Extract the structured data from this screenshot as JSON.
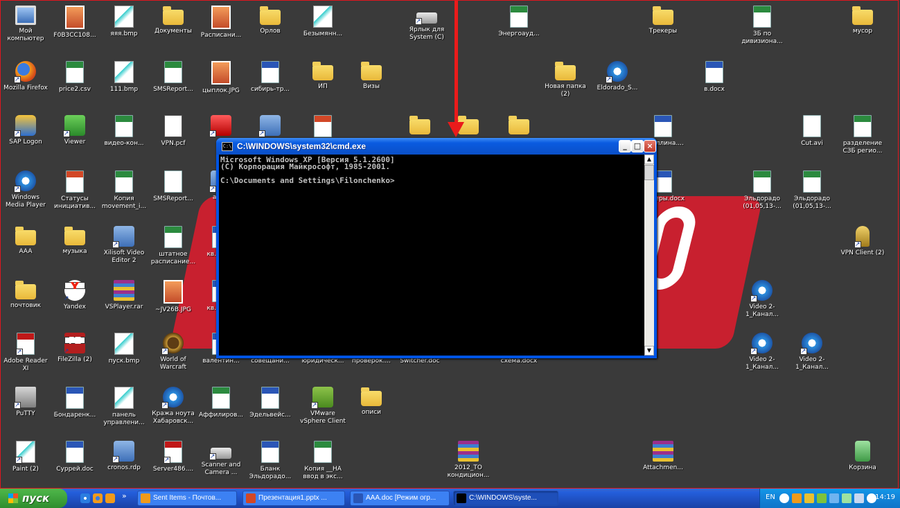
{
  "desktop": {
    "icons": [
      {
        "label": "Мой компьютер",
        "type": "computer"
      },
      {
        "label": "F0B3CC108...",
        "type": "jpg"
      },
      {
        "label": "яяя.bmp",
        "type": "paint"
      },
      {
        "label": "Документы",
        "type": "folder"
      },
      {
        "label": "Расписани...",
        "type": "jpg"
      },
      {
        "label": "Орлов",
        "type": "folder"
      },
      {
        "label": "Безымянн...",
        "type": "paint"
      },
      {
        "label": "Ярлык для System (C)",
        "type": "drive"
      },
      {
        "label": "Энергоауд...",
        "type": "excel"
      },
      {
        "label": "Трекеры",
        "type": "folder"
      },
      {
        "label": "3Б по дивизиона...",
        "type": "excel"
      },
      {
        "label": "мусор",
        "type": "folder"
      },
      {
        "label": "Mozilla Firefox",
        "type": "firefox"
      },
      {
        "label": "price2.csv",
        "type": "excel"
      },
      {
        "label": "111.bmp",
        "type": "paint"
      },
      {
        "label": "SMSReport...",
        "type": "excel"
      },
      {
        "label": "цыплок.JPG",
        "type": "jpg"
      },
      {
        "label": "сибирь-тр...",
        "type": "word"
      },
      {
        "label": "ИП",
        "type": "folder"
      },
      {
        "label": "Визы",
        "type": "folder"
      },
      {
        "label": "Новая папка (2)",
        "type": "folder"
      },
      {
        "label": "Eldorado_S...",
        "type": "media"
      },
      {
        "label": "в.docx",
        "type": "word"
      },
      {
        "label": "SAP Logon",
        "type": "sap"
      },
      {
        "label": "Viewer",
        "type": "green"
      },
      {
        "label": "видео-кон...",
        "type": "excel"
      },
      {
        "label": "VPN.pcf",
        "type": "pcf"
      },
      {
        "label": "",
        "type": "red"
      },
      {
        "label": "",
        "type": "generic"
      },
      {
        "label": "",
        "type": "ppt"
      },
      {
        "label": "",
        "type": "folder"
      },
      {
        "label": "",
        "type": "folder"
      },
      {
        "label": "",
        "type": "folder"
      },
      {
        "label": "...ауллина....",
        "type": "word"
      },
      {
        "label": "Cut.avi",
        "type": "doc"
      },
      {
        "label": "разделение СЗБ регио...",
        "type": "excel"
      },
      {
        "label": "Windows Media Player",
        "type": "media"
      },
      {
        "label": "Статусы инициатив...",
        "type": "ppt"
      },
      {
        "label": "Копия movement_i...",
        "type": "excel"
      },
      {
        "label": "SMSReport...",
        "type": "doc"
      },
      {
        "label": "а_2...",
        "type": "generic"
      },
      {
        "label": "...екеры.docx",
        "type": "word"
      },
      {
        "label": "Эльдорадо (01,05,13-...",
        "type": "excel"
      },
      {
        "label": "Эльдорадо (01,05,13-...",
        "type": "excel"
      },
      {
        "label": "AAA",
        "type": "folder"
      },
      {
        "label": "музыка",
        "type": "folder"
      },
      {
        "label": "Xilisoft Video Editor 2",
        "type": "generic"
      },
      {
        "label": "штатное расписание...",
        "type": "excel"
      },
      {
        "label": "кв... св...",
        "type": "word"
      },
      {
        "label": "VPN Client (2)",
        "type": "vpn"
      },
      {
        "label": "почтовик",
        "type": "folder"
      },
      {
        "label": "Yandex",
        "type": "yandex"
      },
      {
        "label": "VSPlayer.rar",
        "type": "rar"
      },
      {
        "label": "~JV26B.JPG",
        "type": "jpg"
      },
      {
        "label": "кв... св...",
        "type": "word"
      },
      {
        "label": "Video 2-1_Канал...",
        "type": "media"
      },
      {
        "label": "Adobe Reader XI",
        "type": "pdf"
      },
      {
        "label": "FileZilla (2)",
        "type": "filezilla"
      },
      {
        "label": "пуск.bmp",
        "type": "paint"
      },
      {
        "label": "World of Warcraft",
        "type": "wow"
      },
      {
        "label": "валентин...",
        "type": "word"
      },
      {
        "label": "совещани...",
        "type": "word"
      },
      {
        "label": "юридическ...",
        "type": "word"
      },
      {
        "label": "проверок....",
        "type": "word"
      },
      {
        "label": "Switcher.doc",
        "type": "word"
      },
      {
        "label": "схема.docx",
        "type": "word"
      },
      {
        "label": "Video 2-1_Канал...",
        "type": "media"
      },
      {
        "label": "Video 2-1_Канал...",
        "type": "media"
      },
      {
        "label": "PuTTY",
        "type": "putty"
      },
      {
        "label": "Бондаренк...",
        "type": "word"
      },
      {
        "label": "панель управлени...",
        "type": "paint"
      },
      {
        "label": "Кража ноута Хабаровск...",
        "type": "media"
      },
      {
        "label": "Аффилиров...",
        "type": "excel"
      },
      {
        "label": "Эдельвейс...",
        "type": "word"
      },
      {
        "label": "VMware vSphere Client",
        "type": "vmware"
      },
      {
        "label": "описи",
        "type": "folder"
      },
      {
        "label": "Paint (2)",
        "type": "paintapp"
      },
      {
        "label": "Суррей.doc",
        "type": "word"
      },
      {
        "label": "cronos.rdp",
        "type": "generic"
      },
      {
        "label": "Server486....",
        "type": "pdf"
      },
      {
        "label": "Scanner and Camera ...",
        "type": "drive"
      },
      {
        "label": "Бланк Эльдорадо...",
        "type": "word"
      },
      {
        "label": "Копия __НА ввод в экс...",
        "type": "excel"
      },
      {
        "label": "2012_ТО кондицион...",
        "type": "rar"
      },
      {
        "label": "Attachmen...",
        "type": "rar"
      },
      {
        "label": "Корзина",
        "type": "recycle"
      }
    ]
  },
  "cmd_window": {
    "title": "C:\\WINDOWS\\system32\\cmd.exe",
    "icon_label": "C:\\",
    "lines": [
      "Microsoft Windows XP [Версия 5.1.2600]",
      "(С) Корпорация Майкрософт, 1985-2001.",
      "",
      "C:\\Documents and Settings\\Filonchenko>"
    ],
    "minimize": "_",
    "maximize": "□",
    "close": "×"
  },
  "taskbar": {
    "start_label": "пуск",
    "quick_launch_more": "»",
    "tasks": [
      {
        "label": "Sent Items - Почтов...",
        "icon_color": "#f09a1a",
        "active": false
      },
      {
        "label": "Презентация1.pptx ...",
        "icon_color": "#d24726",
        "active": false
      },
      {
        "label": "AAA.doc [Режим огр...",
        "icon_color": "#2a56b6",
        "active": false
      },
      {
        "label": "C:\\WINDOWS\\syste...",
        "icon_color": "#000000",
        "active": true
      }
    ],
    "tray": {
      "language": "EN",
      "clock": "14:19"
    }
  },
  "colors": {
    "desktop_bg": "#3a3a3a",
    "accent_red": "#ea1b1b",
    "xp_blue": "#245edb",
    "start_green": "#3c9a37"
  }
}
